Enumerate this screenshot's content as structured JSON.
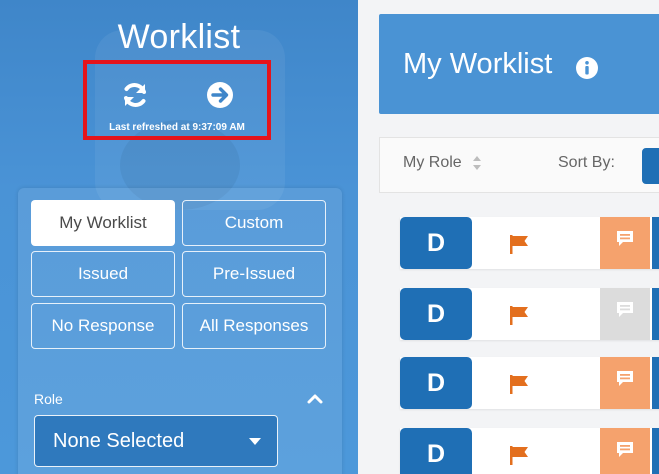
{
  "sidebar": {
    "title": "Worklist",
    "refresh_icon": "refresh-icon",
    "go_icon": "arrow-right-circle-icon",
    "last_refreshed": "Last refreshed at 9:37:09 AM",
    "highlight_color": "#e5141b",
    "filters": [
      {
        "label": "My Worklist",
        "active": true
      },
      {
        "label": "Custom",
        "active": false
      },
      {
        "label": "Issued",
        "active": false
      },
      {
        "label": "Pre-Issued",
        "active": false
      },
      {
        "label": "No Response",
        "active": false
      },
      {
        "label": "All Responses",
        "active": false
      }
    ],
    "role": {
      "label": "Role",
      "selected": "None Selected"
    }
  },
  "main": {
    "title": "My Worklist",
    "info_icon": "info-icon",
    "toolbar": {
      "my_role_label": "My Role",
      "sort_by_label": "Sort By:"
    },
    "rows": [
      {
        "badge": "D",
        "flag_color": "#e36f1e",
        "status_color": "#f5a26d"
      },
      {
        "badge": "D",
        "flag_color": "#e36f1e",
        "status_color": "#dcdcdc"
      },
      {
        "badge": "D",
        "flag_color": "#e36f1e",
        "status_color": "#f5a26d"
      },
      {
        "badge": "D",
        "flag_color": "#e36f1e",
        "status_color": "#f5a26d"
      }
    ]
  },
  "colors": {
    "sidebar_bg": "#4a93d6",
    "header_bg": "#4a93d4",
    "badge_bg": "#1f6fb5",
    "flag": "#e36f1e"
  }
}
